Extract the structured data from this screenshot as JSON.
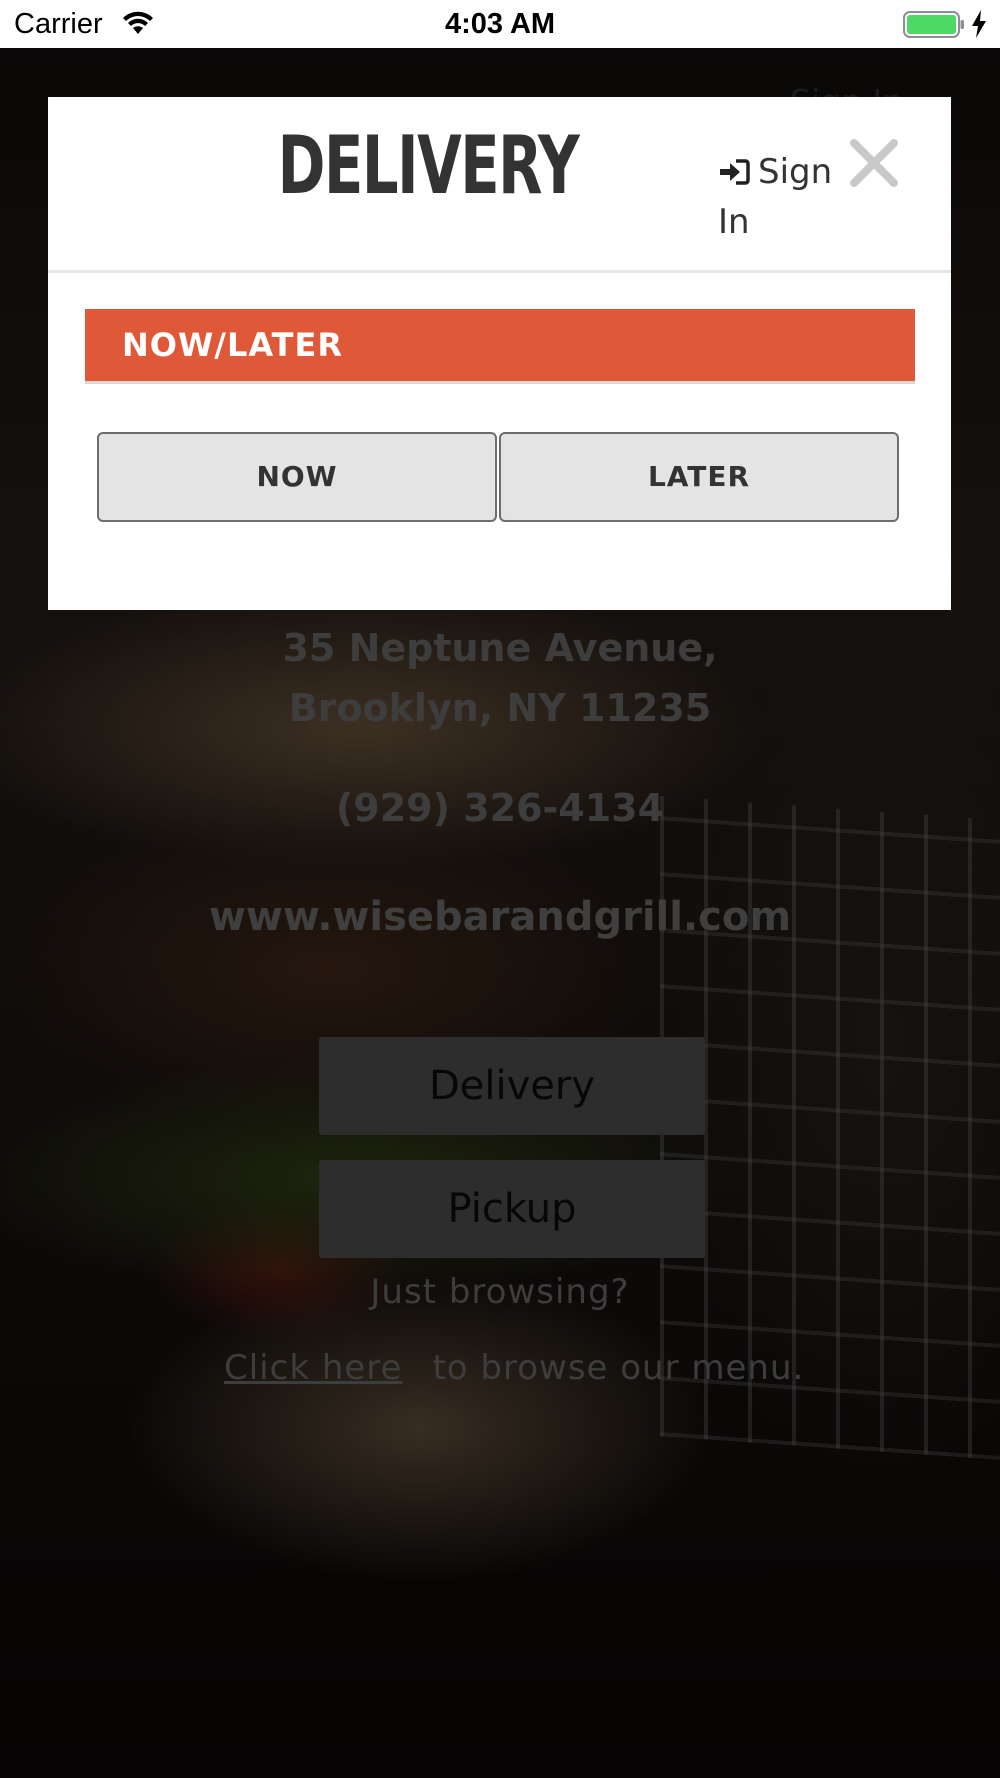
{
  "status_bar": {
    "carrier": "Carrier",
    "time": "4:03 AM",
    "battery_color": "#4cd964"
  },
  "landing": {
    "sign_in": "Sign In",
    "address_line1": "35 Neptune Avenue,",
    "address_line2": "Brooklyn, NY 11235",
    "phone": "(929) 326-4134",
    "website": "www.wisebarandgrill.com",
    "delivery_button": "Delivery",
    "pickup_button": "Pickup",
    "browse_question": "Just browsing?",
    "browse_link": "Click here",
    "browse_rest": "to browse our menu."
  },
  "modal": {
    "title": "DELIVERY",
    "sign_in": "Sign In",
    "close_icon": "close-icon",
    "section_label": "NOW/LATER",
    "accent_color": "#df5838",
    "options": [
      "NOW",
      "LATER"
    ]
  }
}
